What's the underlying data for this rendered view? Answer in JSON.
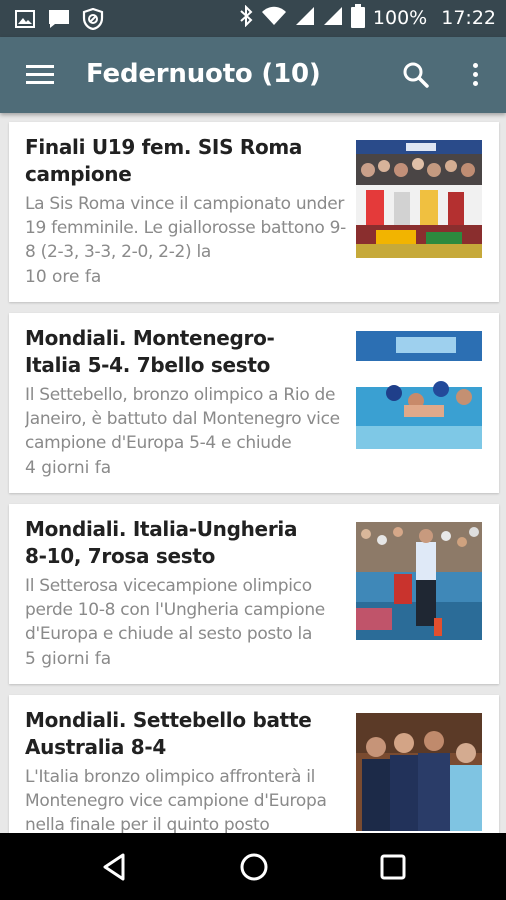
{
  "status_bar": {
    "battery_text": "100%",
    "time": "17:22",
    "left_icons": [
      "image-icon",
      "message-icon",
      "blocked-icon"
    ],
    "right_icons": [
      "bluetooth-icon",
      "wifi-icon",
      "signal-icon",
      "signal-icon",
      "battery-icon"
    ]
  },
  "app_bar": {
    "title": "Federnuoto (10)",
    "background": "#4f6c78"
  },
  "articles": [
    {
      "title": "Finali U19 fem. SIS Roma campione",
      "summary": "La Sis Roma vince il campionato under 19 femminile. Le giallorosse battono 9-8 (2-3, 3-3, 2-0, 2-2) la",
      "time": "10 ore fa"
    },
    {
      "title": "Mondiali. Montenegro-Italia 5-4. 7bello sesto",
      "summary": "Il Settebello, bronzo olimpico a Rio de Janeiro, è battuto dal Montenegro vice campione d'Europa 5-4 e chiude",
      "time": "4 giorni fa"
    },
    {
      "title": "Mondiali. Italia-Ungheria 8-10, 7rosa sesto",
      "summary": "Il Setterosa vicecampione olimpico perde 10-8 con l'Ungheria campione d'Europa e chiude al sesto posto la",
      "time": "5 giorni fa"
    },
    {
      "title": "Mondiali. Settebello batte Australia 8-4",
      "summary": "L'Italia bronzo olimpico affronterà il Montenegro vice campione d'Europa nella finale per il quinto posto",
      "time": ""
    }
  ],
  "nav_bar": {
    "buttons": [
      "back-icon",
      "home-icon",
      "recents-icon"
    ]
  }
}
